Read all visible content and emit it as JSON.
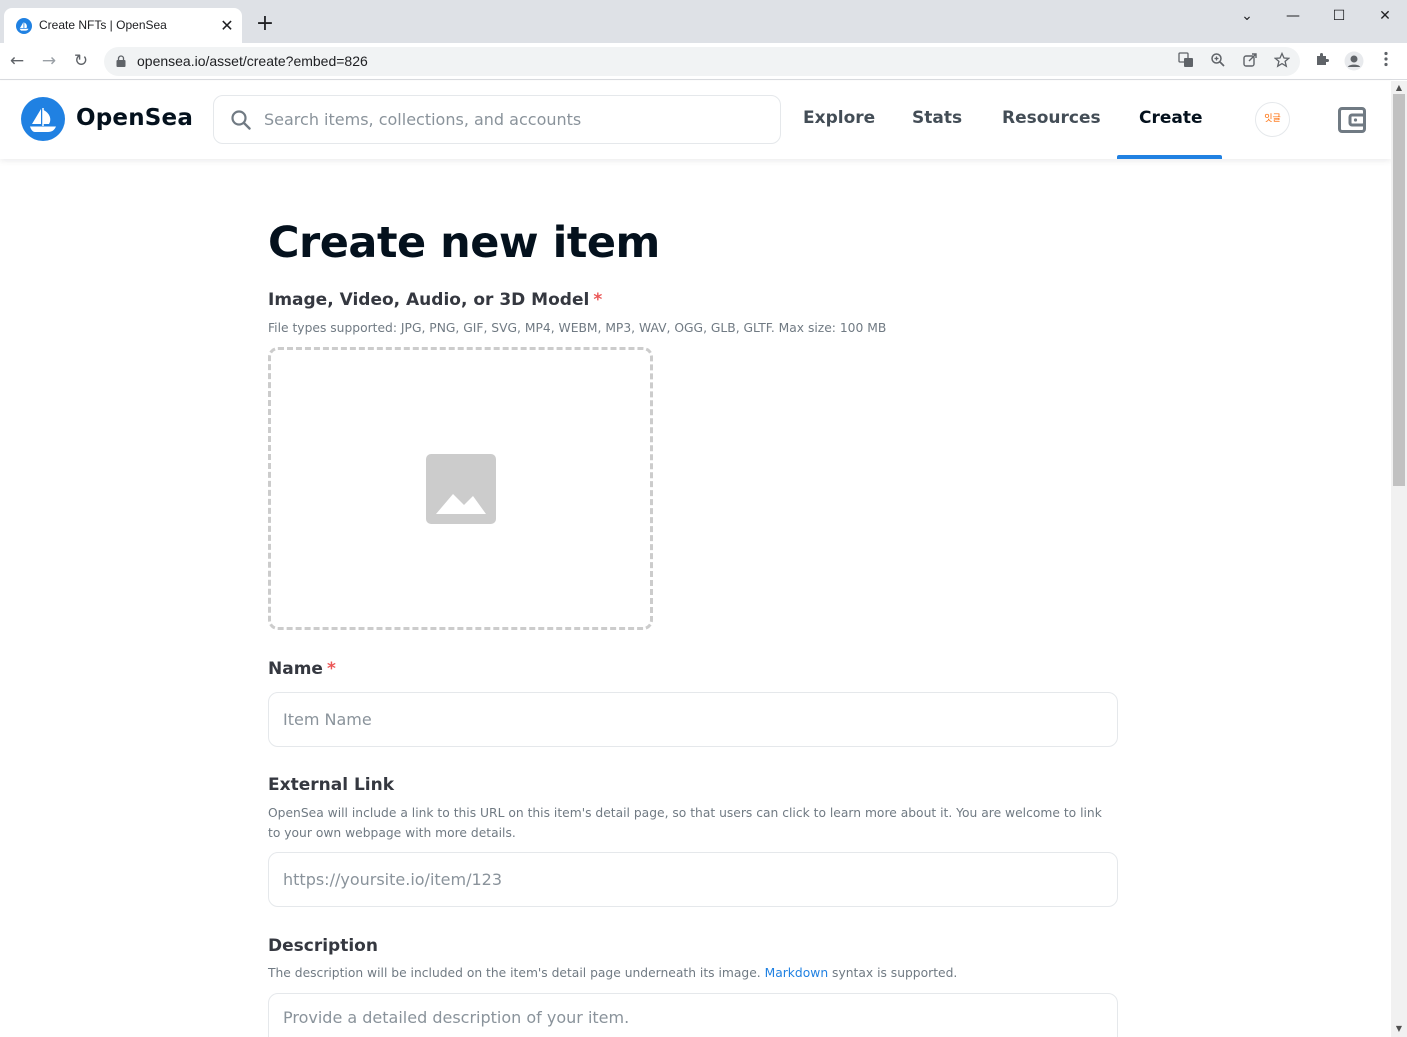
{
  "browser": {
    "tab_title": "Create NFTs | OpenSea",
    "tab_close": "✕",
    "new_tab": "+",
    "url": "opensea.io/asset/create?embed=826",
    "window_controls": {
      "dropdown": "⌄",
      "minimize": "—",
      "maximize": "☐",
      "close": "✕"
    },
    "nav": {
      "back": "←",
      "forward": "→",
      "reload": "↻"
    },
    "omnibox_icons": [
      "translate-icon",
      "zoom-icon",
      "share-icon",
      "star-icon"
    ],
    "toolbar_icons": [
      "extensions-icon",
      "profile-icon",
      "menu-icon"
    ]
  },
  "header": {
    "brand": "OpenSea",
    "search_placeholder": "Search items, collections, and accounts",
    "nav": [
      "Explore",
      "Stats",
      "Resources",
      "Create"
    ],
    "active_nav": "Create",
    "avatar_text": "잇글",
    "accent_color": "#2081e2"
  },
  "form": {
    "title": "Create new item",
    "media": {
      "label": "Image, Video, Audio, or 3D Model",
      "required": "*",
      "hint": "File types supported: JPG, PNG, GIF, SVG, MP4, WEBM, MP3, WAV, OGG, GLB, GLTF. Max size: 100 MB"
    },
    "name": {
      "label": "Name",
      "required": "*",
      "placeholder": "Item Name"
    },
    "external_link": {
      "label": "External Link",
      "hint": "OpenSea will include a link to this URL on this item's detail page, so that users can click to learn more about it. You are welcome to link to your own webpage with more details.",
      "placeholder": "https://yoursite.io/item/123"
    },
    "description": {
      "label": "Description",
      "hint_before": "The description will be included on the item's detail page underneath its image.",
      "hint_link": "Markdown",
      "hint_after": "syntax is supported.",
      "placeholder": "Provide a detailed description of your item."
    }
  }
}
